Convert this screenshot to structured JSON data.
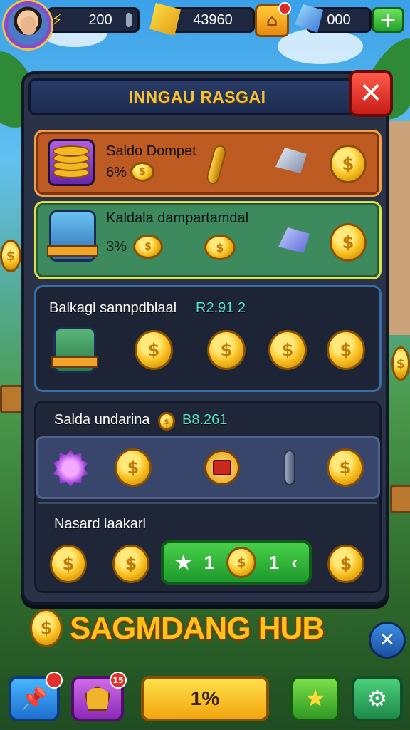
{
  "hud": {
    "energy_value": "200",
    "gold_value": "43960",
    "gems_value": "000"
  },
  "panel": {
    "title": "INNGAU RASGAI",
    "card_wallet": {
      "title": "Saldo Dompet",
      "percent": "6%"
    },
    "card_bonus": {
      "title": "Kaldala dampartamdal",
      "percent": "3%"
    },
    "card_savings": {
      "title": "Balkagl sannpdblaal",
      "amount": "R2.91 2"
    },
    "card_pending": {
      "title": "Salda undarina",
      "amount": "B8.261"
    },
    "card_rewards": {
      "title": "Nasard laakarl",
      "claim_left": "1",
      "claim_right": "1"
    }
  },
  "logo": {
    "text": "SAGMDANG HUB"
  },
  "bottom_bar": {
    "main_button_label": "1%",
    "badge_count": "15"
  },
  "icons": {
    "coin": "$",
    "close": "✕",
    "plus": "+",
    "star": "★",
    "settings": "⚙"
  }
}
